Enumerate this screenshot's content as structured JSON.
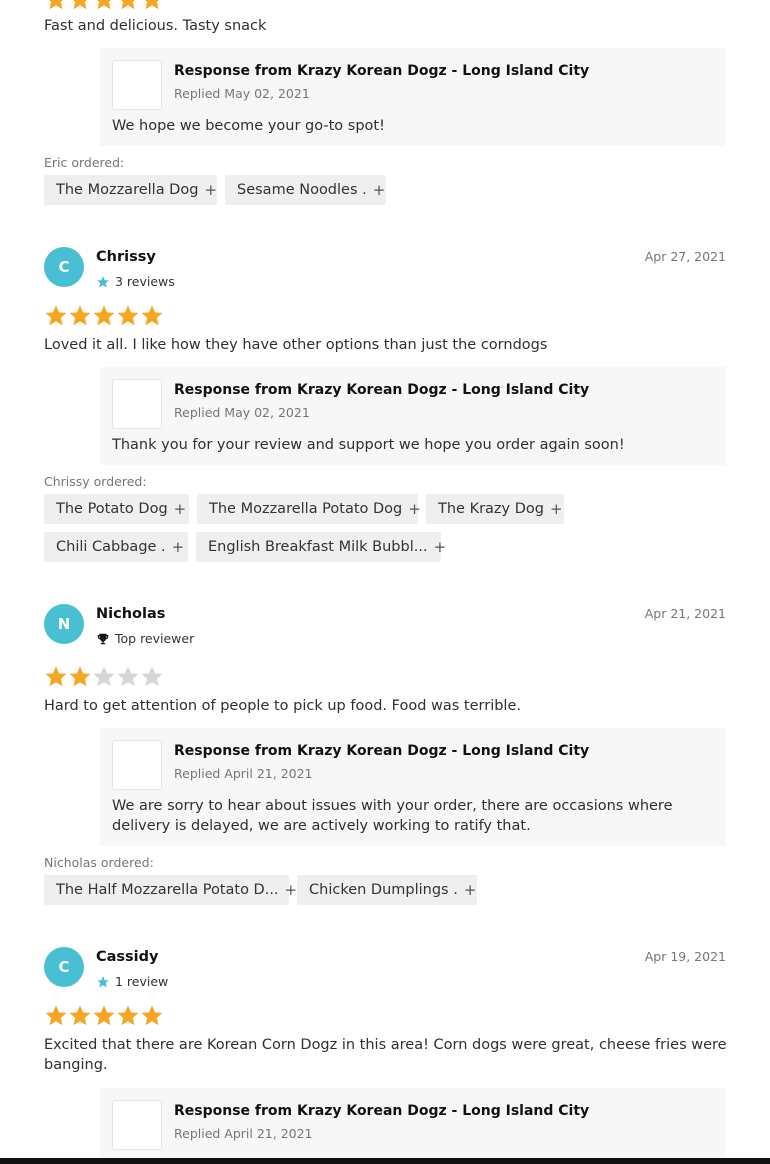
{
  "colors": {
    "star_filled": "#f5a623",
    "star_empty": "#d6d6d6",
    "avatar": "#49bfd4",
    "badge_star": "#49bfd4"
  },
  "top_review": {
    "rating": 5,
    "text": "Fast and delicious. Tasty snack",
    "response": {
      "title": "Response from Krazy Korean Dogz - Long Island City",
      "date": "Replied May 02, 2021",
      "text": "We hope we become your go-to spot!"
    },
    "ordered_label": "Eric ordered:",
    "items": [
      "The Mozzarella Dog",
      "Sesame Noodles ."
    ]
  },
  "reviews": [
    {
      "initial": "C",
      "name": "Chrissy",
      "badge_icon": "star-icon",
      "badge_text": "3 reviews",
      "date": "Apr 27, 2021",
      "rating": 5,
      "text": "Loved it all. I like how they have other options than just the corndogs",
      "response": {
        "title": "Response from Krazy Korean Dogz - Long Island City",
        "date": "Replied May 02, 2021",
        "text": "Thank you for your review and support we hope you order again soon!"
      },
      "ordered_label": "Chrissy ordered:",
      "items": [
        "The Potato Dog",
        "The Mozzarella Potato Dog",
        "The Krazy Dog",
        "Chili Cabbage .",
        "English Breakfast Milk Bubbl..."
      ]
    },
    {
      "initial": "N",
      "name": "Nicholas",
      "badge_icon": "trophy-icon",
      "badge_text": "Top reviewer",
      "date": "Apr 21, 2021",
      "rating": 2,
      "text": "Hard to get attention of people to pick up food. Food was terrible.",
      "response": {
        "title": "Response from Krazy Korean Dogz - Long Island City",
        "date": "Replied April 21, 2021",
        "text": "We are sorry to hear about issues with your order, there are occasions where delivery is delayed, we are actively working to ratify that."
      },
      "ordered_label": "Nicholas ordered:",
      "items": [
        "The Half Mozzarella Potato D...",
        "Chicken Dumplings ."
      ]
    },
    {
      "initial": "C",
      "name": "Cassidy",
      "badge_icon": "star-icon",
      "badge_text": "1 review",
      "date": "Apr 19, 2021",
      "rating": 5,
      "text": "Excited that there are Korean Corn Dogz in this area! Corn dogs were great, cheese fries were banging.",
      "response": {
        "title": "Response from Krazy Korean Dogz - Long Island City",
        "date": "Replied April 21, 2021"
      }
    }
  ]
}
